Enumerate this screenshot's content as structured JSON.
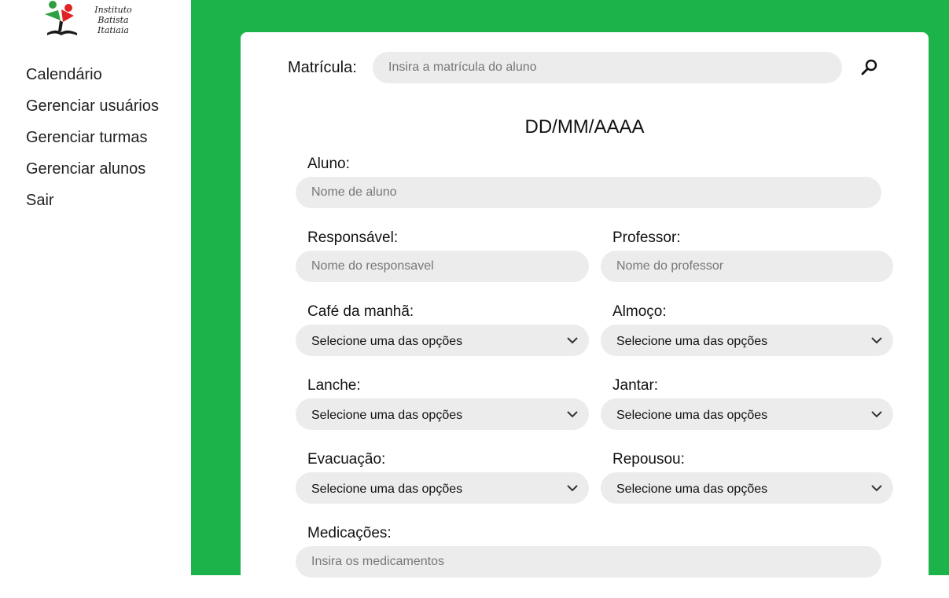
{
  "logo": {
    "text_line1": "Instituto Batista",
    "text_line2": "Itatiaia"
  },
  "nav": {
    "items": [
      {
        "label": "Calendário"
      },
      {
        "label": "Gerenciar usuários"
      },
      {
        "label": "Gerenciar turmas"
      },
      {
        "label": "Gerenciar alunos"
      },
      {
        "label": "Sair"
      }
    ]
  },
  "form": {
    "matricula_label": "Matrícula:",
    "matricula_placeholder": "Insira a matrícula do aluno",
    "date": "DD/MM/AAAA",
    "aluno_label": "Aluno:",
    "aluno_placeholder": "Nome de aluno",
    "responsavel_label": "Responsável:",
    "responsavel_placeholder": "Nome do responsavel",
    "professor_label": "Professor:",
    "professor_placeholder": "Nome do professor",
    "cafe_label": "Café da manhã:",
    "almoco_label": "Almoço:",
    "lanche_label": "Lanche:",
    "jantar_label": "Jantar:",
    "evacuacao_label": "Evacuação:",
    "repousou_label": "Repousou:",
    "select_placeholder": "Selecione uma das opções",
    "medicacoes_label": "Medicações:",
    "medicacoes_placeholder": "Insira os medicamentos"
  },
  "colors": {
    "accent": "#1db34b",
    "field_bg": "#ececec"
  },
  "icons": {
    "search": "search-icon",
    "chevron": "chevron-down-icon"
  }
}
